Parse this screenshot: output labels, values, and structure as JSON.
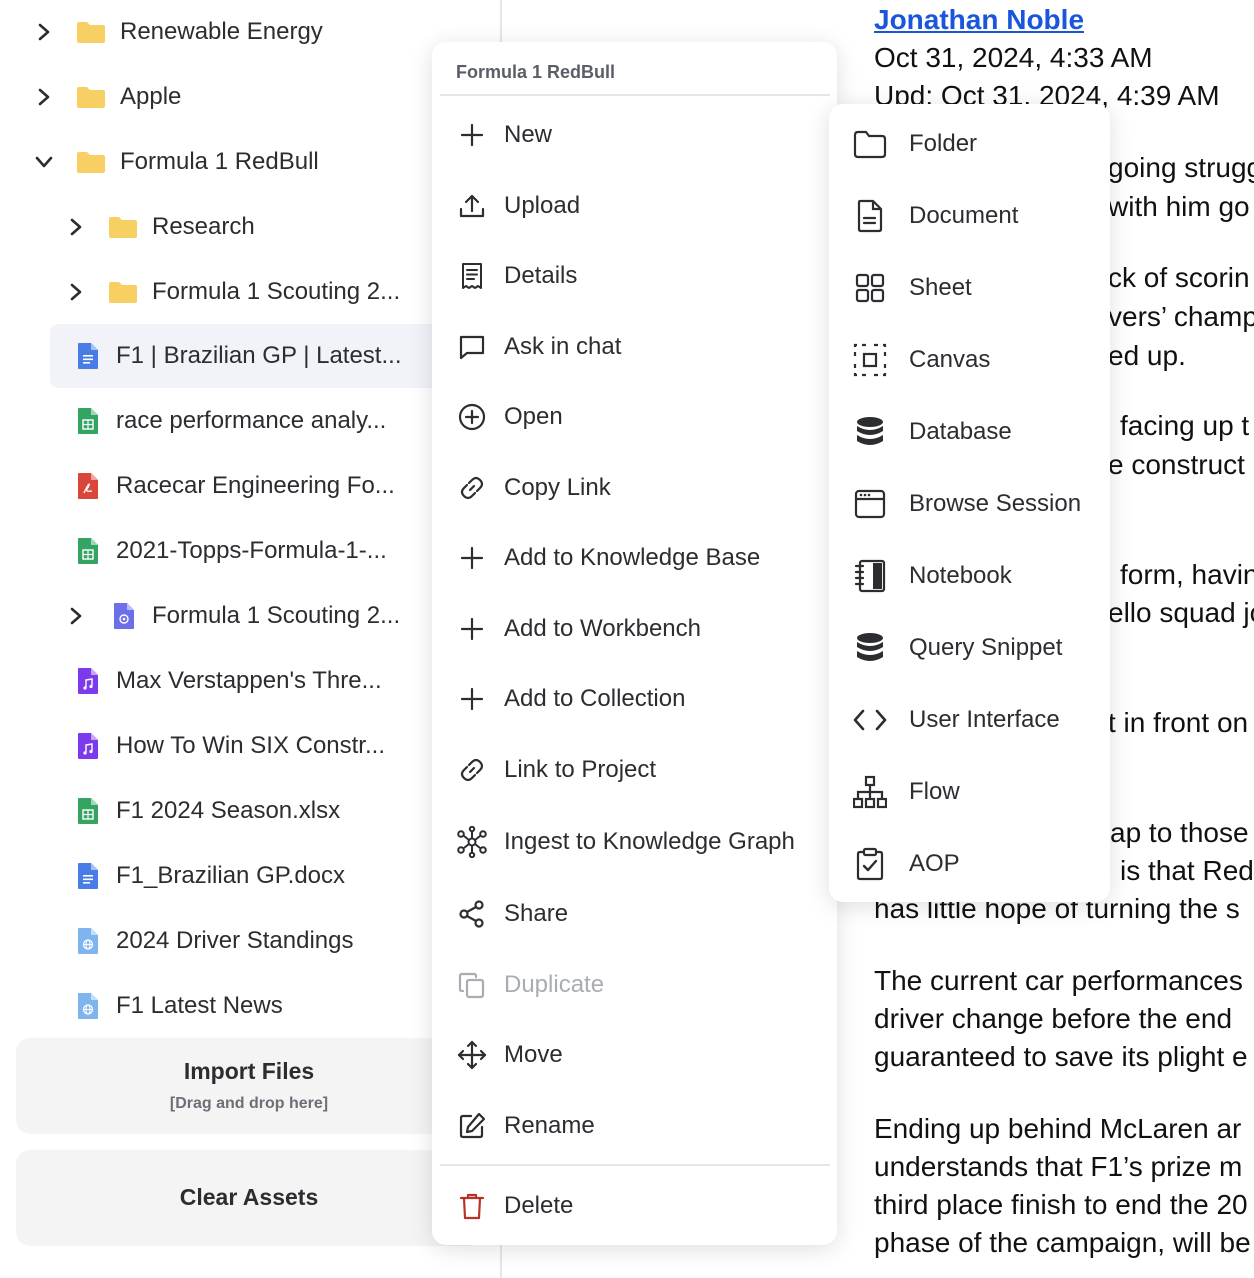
{
  "tree": {
    "items": [
      {
        "label": "Renewable Energy"
      },
      {
        "label": "Apple"
      },
      {
        "label": "Formula 1 RedBull"
      },
      {
        "label": "Research"
      },
      {
        "label": "Formula 1 Scouting 2..."
      },
      {
        "label": "F1 | Brazilian GP | Latest..."
      },
      {
        "label": "race performance analy..."
      },
      {
        "label": "Racecar Engineering Fo..."
      },
      {
        "label": "2021-Topps-Formula-1-..."
      },
      {
        "label": "Formula 1 Scouting 2..."
      },
      {
        "label": "Max Verstappen's Thre..."
      },
      {
        "label": "How To Win SIX Constr..."
      },
      {
        "label": "F1 2024 Season.xlsx"
      },
      {
        "label": "F1_Brazilian GP.docx"
      },
      {
        "label": "2024 Driver Standings"
      },
      {
        "label": "F1 Latest News"
      }
    ],
    "import_label": "Import Files",
    "import_hint": "[Drag and drop here]",
    "clear_label": "Clear Assets"
  },
  "menu": {
    "title": "Formula 1 RedBull",
    "items": [
      {
        "label": "New",
        "icon": "plus-icon"
      },
      {
        "label": "Upload",
        "icon": "upload-icon"
      },
      {
        "label": "Details",
        "icon": "details-icon"
      },
      {
        "label": "Ask in chat",
        "icon": "chat-icon"
      },
      {
        "label": "Open",
        "icon": "open-icon"
      },
      {
        "label": "Copy Link",
        "icon": "link-icon"
      },
      {
        "label": "Add to Knowledge Base",
        "icon": "plus-icon"
      },
      {
        "label": "Add to Workbench",
        "icon": "plus-icon"
      },
      {
        "label": "Add to Collection",
        "icon": "plus-icon"
      },
      {
        "label": "Link to Project",
        "icon": "link-icon"
      },
      {
        "label": "Ingest to Knowledge Graph",
        "icon": "graph-icon"
      },
      {
        "label": "Share",
        "icon": "share-icon"
      },
      {
        "label": "Duplicate",
        "icon": "duplicate-icon"
      },
      {
        "label": "Move",
        "icon": "move-icon"
      },
      {
        "label": "Rename",
        "icon": "rename-icon"
      },
      {
        "label": "Delete",
        "icon": "trash-icon"
      }
    ]
  },
  "submenu": {
    "items": [
      {
        "label": "Folder",
        "icon": "folder-icon"
      },
      {
        "label": "Document",
        "icon": "document-icon"
      },
      {
        "label": "Sheet",
        "icon": "sheet-icon"
      },
      {
        "label": "Canvas",
        "icon": "canvas-icon"
      },
      {
        "label": "Database",
        "icon": "database-icon"
      },
      {
        "label": "Browse Session",
        "icon": "browser-icon"
      },
      {
        "label": "Notebook",
        "icon": "notebook-icon"
      },
      {
        "label": "Query Snippet",
        "icon": "database-icon"
      },
      {
        "label": "User Interface",
        "icon": "code-icon"
      },
      {
        "label": "Flow",
        "icon": "flow-icon"
      },
      {
        "label": "AOP",
        "icon": "clipboard-check-icon"
      }
    ]
  },
  "doc": {
    "author": "Jonathan Noble",
    "date": "Oct 31, 2024, 4:33 AM",
    "updated": "Upd: Oct 31, 2024, 4:39 AM",
    "lines": [
      "going strugg",
      "with him go",
      "ck of scorin",
      "vers’ champ",
      "ed up.",
      "facing up t",
      "e construct",
      "form, havin",
      "ello squad jo",
      "t in front on",
      "ap to those",
      "is that Red",
      "has little hope of turning the s",
      "The current car performances",
      "driver change before the end",
      "guaranteed to save its plight e",
      "Ending up behind McLaren ar",
      "understands that F1’s prize m",
      "third place finish to end the 20",
      "phase of the campaign, will be"
    ]
  },
  "colors": {
    "folder": "#f8cf63",
    "doc_blue": "#4a7ce8",
    "sheet_green": "#33a462",
    "pdf_red": "#d9463a",
    "audio_purple": "#7c3aed",
    "web_lightblue": "#7fb5ef",
    "link": "#1a56db",
    "danger": "#b8322a"
  }
}
